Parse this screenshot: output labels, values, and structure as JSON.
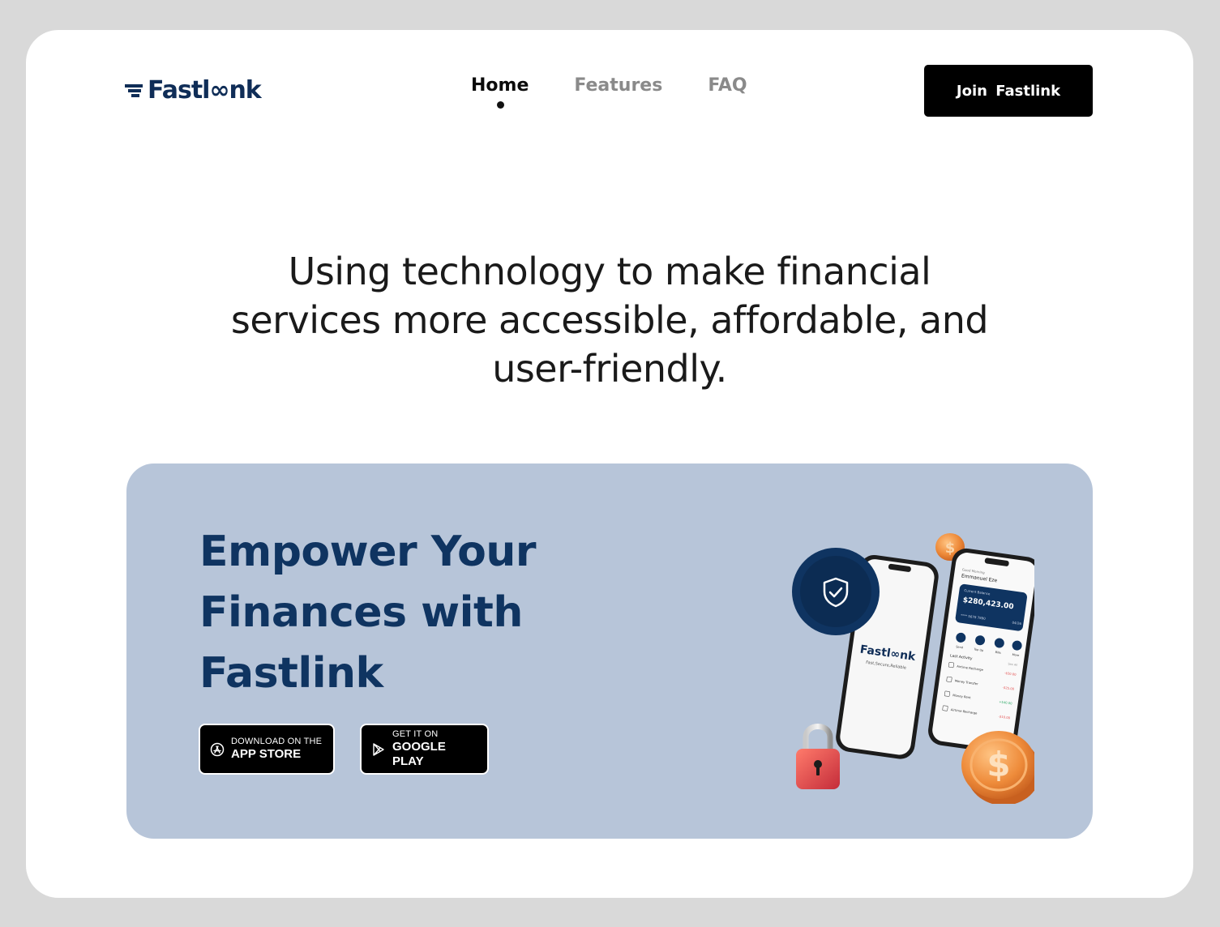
{
  "brand": {
    "logo_text": "Fastl∞nk",
    "tagline": "Fast,Secure,Reliable"
  },
  "nav": {
    "items": [
      {
        "label": "Home",
        "active": true
      },
      {
        "label": "Features",
        "active": false
      },
      {
        "label": "FAQ",
        "active": false
      }
    ]
  },
  "header": {
    "join_label": "Join  Fastlink"
  },
  "headline": "Using technology to make financial services more accessible, affordable, and user-friendly.",
  "hero": {
    "title": "Empower Your Finances with Fastlink",
    "app_store": {
      "small": "DOWNLOAD ON THE",
      "big": "APP STORE"
    },
    "google_play": {
      "small": "GET IT ON",
      "big": "GOOGLE PLAY"
    }
  },
  "phone": {
    "greeting": "Good Morning",
    "user": "Emmanuel Eze",
    "balance_label": "Current Balance",
    "balance": "$280,423.00",
    "card_number": "**** 5678 7890",
    "card_expiry": "04/26",
    "last_activity": "Last Activity",
    "see_all": "See All",
    "actions": [
      "Send",
      "Top Up",
      "Bills",
      "More"
    ],
    "activities": [
      {
        "name": "Airtime Recharge",
        "amount": "-$50.00"
      },
      {
        "name": "Money Transfer",
        "amount": "-$25.00"
      },
      {
        "name": "Money Rent",
        "amount": "+$40.00"
      },
      {
        "name": "Airtime Recharge",
        "amount": "-$10.00"
      }
    ]
  },
  "colors": {
    "navy": "#0f3461",
    "hero_bg": "#b7c5d9",
    "frame_bg": "#d9d9d9",
    "coin": "#e98a3a",
    "lock": "#e24a4a"
  }
}
